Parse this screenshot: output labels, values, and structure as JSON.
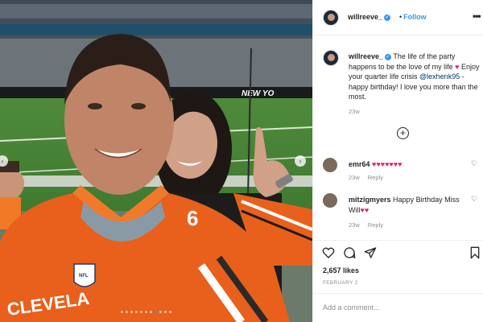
{
  "post": {
    "username": "willreeve_",
    "follow_label": "Follow",
    "separator": "•",
    "caption_before_mention": " The life of the party happens to be the love of my life ",
    "caption_mid": " Enjoy your quarter life crisis ",
    "mention": "@lexhenk95",
    "caption_after_mention": " - happy birthday! I love you more than the most.",
    "caption_time": "23w",
    "likes": "2,657 likes",
    "date": "FEBRUARY 2",
    "add_comment_placeholder": "Add a comment...",
    "more_label": "•••"
  },
  "photo": {
    "stadium_sign": "NEW YO",
    "jersey_text": "CLEVELA",
    "jersey_number": "6",
    "nfl_label": "NFL",
    "carousel_count": 11,
    "carousel_active": 7
  },
  "comments": [
    {
      "username": "emr64",
      "text": "♥♥♥♥♥♥♥",
      "time": "23w",
      "reply": "Reply"
    },
    {
      "username": "mitzigmyers",
      "text": "Happy Birthday Miss Will",
      "hearts": "♥♥",
      "time": "23w",
      "reply": "Reply"
    }
  ],
  "icons": {
    "heart": "heart-icon",
    "comment": "comment-icon",
    "share": "share-icon",
    "save": "bookmark-icon",
    "add": "plus-circle-icon",
    "verified": "verified-badge-icon",
    "prev": "chevron-left-icon",
    "next": "chevron-right-icon"
  },
  "colors": {
    "accent": "#3897f0",
    "heart": "#e0245e",
    "jersey_orange": "#e8601c",
    "mention": "#003569"
  }
}
